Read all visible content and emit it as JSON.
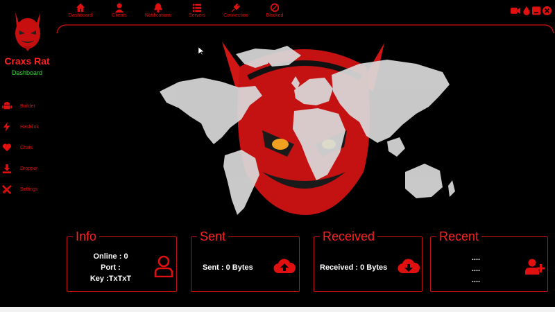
{
  "app": {
    "name": "Craxs Rat",
    "section": "Dashboard"
  },
  "topnav": [
    {
      "label": "Dashboard",
      "icon": "home-icon"
    },
    {
      "label": "Clients",
      "icon": "user-icon"
    },
    {
      "label": "Notifications",
      "icon": "bell-icon"
    },
    {
      "label": "Servers",
      "icon": "list-icon"
    },
    {
      "label": "Connection",
      "icon": "plug-icon"
    },
    {
      "label": "Blocked",
      "icon": "block-icon"
    }
  ],
  "sidebar": [
    {
      "label": "Builder",
      "icon": "android-icon"
    },
    {
      "label": "Hashlink",
      "icon": "bolt-icon"
    },
    {
      "label": "Chats",
      "icon": "heart-icon"
    },
    {
      "label": "Dropper",
      "icon": "download-icon"
    },
    {
      "label": "Settings",
      "icon": "tools-icon"
    }
  ],
  "cards": {
    "info": {
      "title": "Info",
      "online": "Online : 0",
      "port": "Port :",
      "key": "Key :TxTxT",
      "icon": "user-outline-icon"
    },
    "sent": {
      "title": "Sent",
      "text": "Sent : 0 Bytes",
      "icon": "cloud-upload-icon"
    },
    "received": {
      "title": "Received",
      "text": "Received : 0 Bytes",
      "icon": "cloud-download-icon"
    },
    "recent": {
      "title": "Recent",
      "lines": [
        "....",
        "....",
        "...."
      ],
      "icon": "user-plus-icon"
    }
  },
  "colors": {
    "accent": "#e01010",
    "brand_sub": "#33dd33",
    "background": "#000000"
  }
}
